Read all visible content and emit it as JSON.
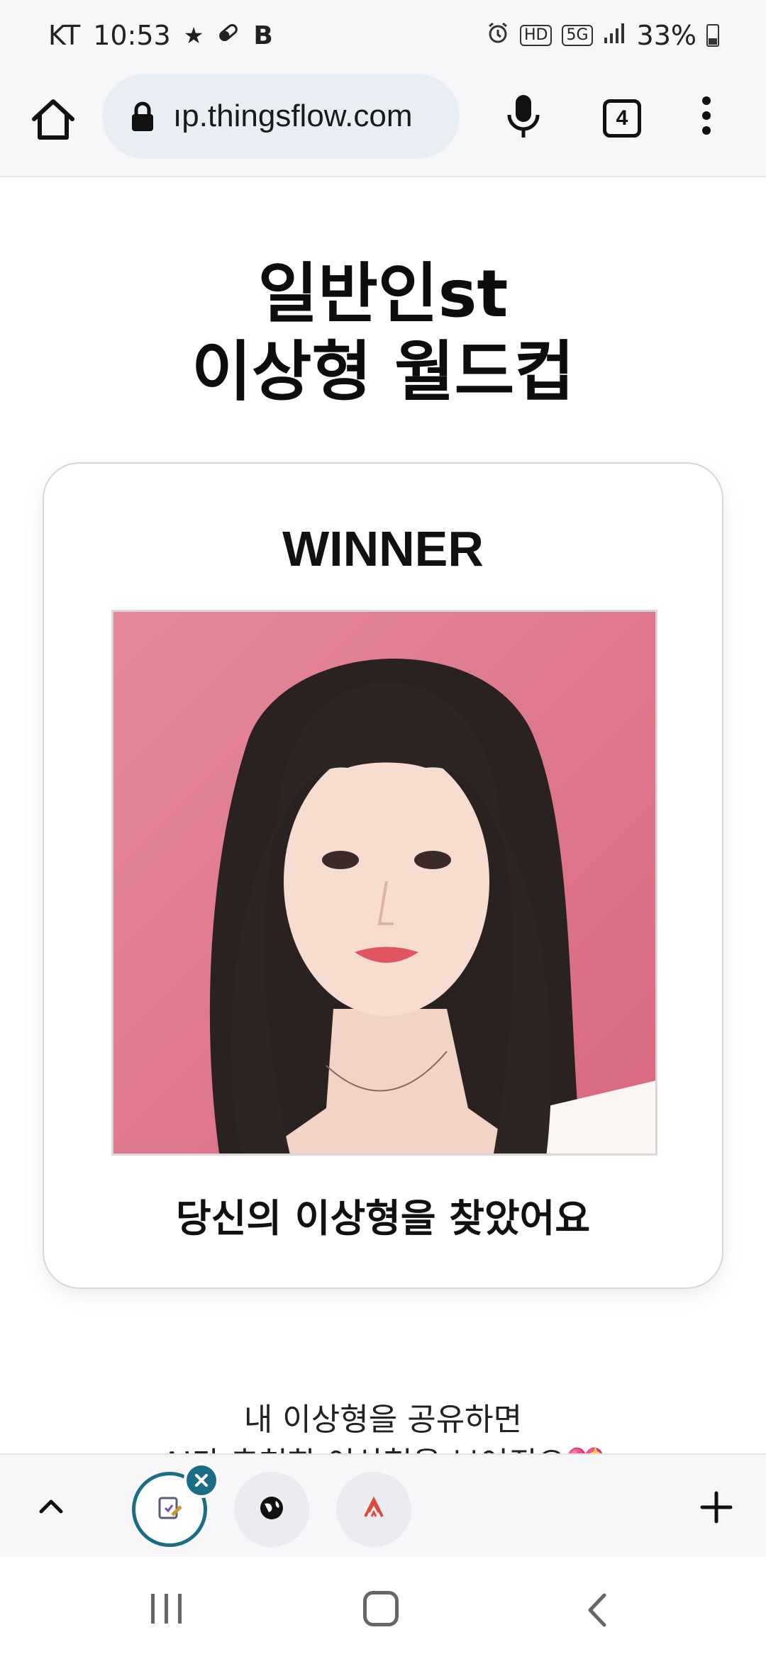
{
  "status_bar": {
    "carrier": "KT",
    "time": "10:53",
    "extra_letter": "B",
    "hd_badge": "HD",
    "network": "5G",
    "battery": "33%",
    "battery_level": 0.33
  },
  "browser": {
    "url": "ıp.thingsflow.com",
    "tab_count": "4"
  },
  "page": {
    "title_line1": "일반인st",
    "title_line2": "이상형 월드컵",
    "winner_label": "WINNER",
    "winner_caption": "당신의 이상형을 찾았어요",
    "share_line1": "내 이상형을 공유하면",
    "share_line2": "AI가 추천한 이상형을 보여줘요💖"
  },
  "icons": {
    "home": "home-icon",
    "lock": "lock-icon",
    "mic": "mic-icon",
    "menu": "more-vert-icon",
    "up": "chevron-up-icon",
    "close": "close-icon",
    "plus": "plus-icon"
  },
  "colors": {
    "accent": "#1d6c86",
    "url_pill": "#e8eef4",
    "photo_bg": "#e07f92"
  }
}
